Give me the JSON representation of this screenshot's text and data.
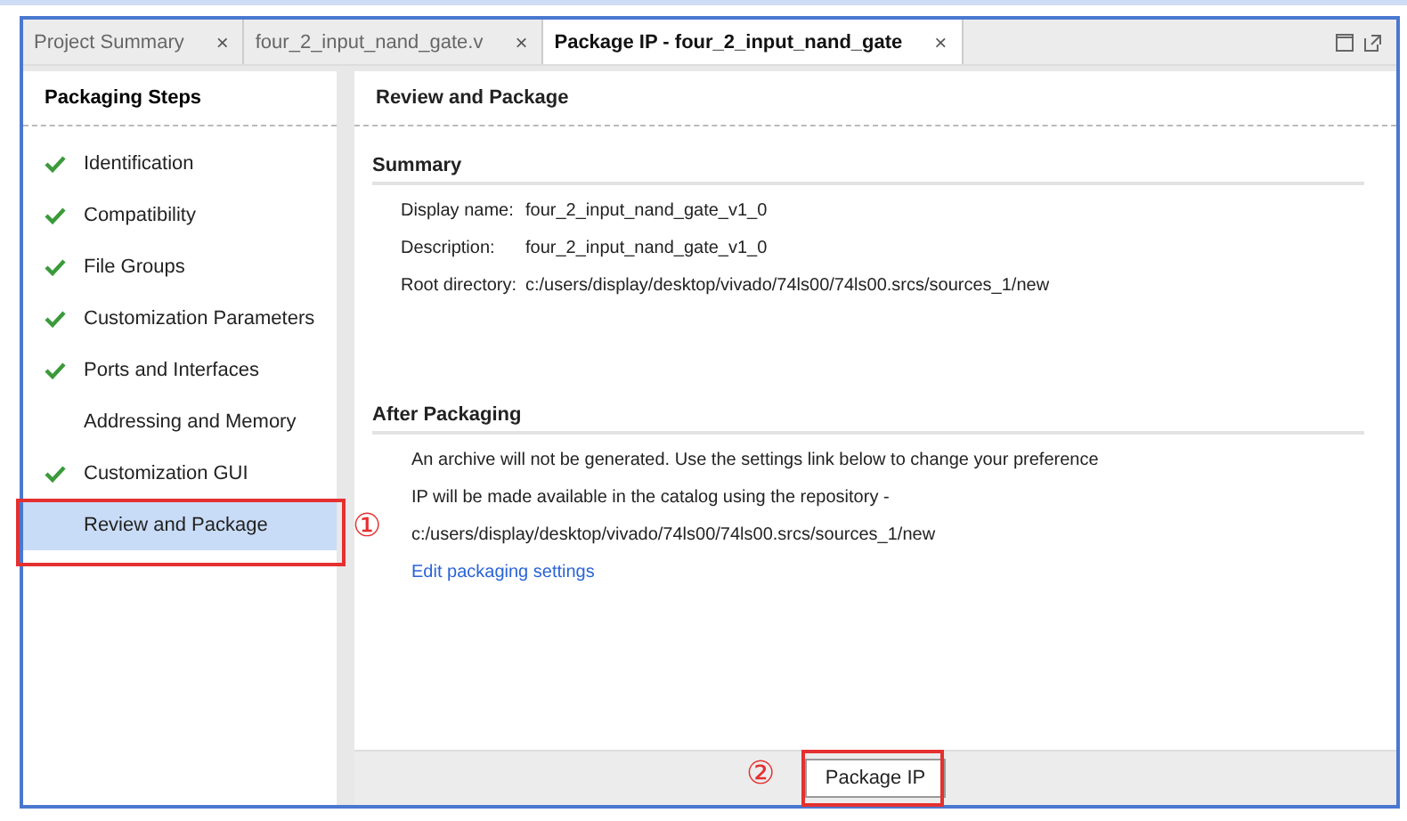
{
  "tabs": [
    {
      "label": "Project Summary",
      "selected": false,
      "close": "×"
    },
    {
      "label": "four_2_input_nand_gate.v",
      "selected": false,
      "close": "×"
    },
    {
      "label": "Package IP - four_2_input_nand_gate",
      "selected": true,
      "close": "×"
    }
  ],
  "sidebar": {
    "title": "Packaging Steps",
    "items": [
      {
        "label": "Identification",
        "done": true,
        "selected": false
      },
      {
        "label": "Compatibility",
        "done": true,
        "selected": false
      },
      {
        "label": "File Groups",
        "done": true,
        "selected": false
      },
      {
        "label": "Customization Parameters",
        "done": true,
        "selected": false
      },
      {
        "label": "Ports and Interfaces",
        "done": true,
        "selected": false
      },
      {
        "label": "Addressing and Memory",
        "done": false,
        "selected": false
      },
      {
        "label": "Customization GUI",
        "done": true,
        "selected": false
      },
      {
        "label": "Review and Package",
        "done": false,
        "selected": true
      }
    ]
  },
  "main": {
    "title": "Review and Package",
    "summary": {
      "title": "Summary",
      "rows": [
        {
          "label": "Display name:",
          "value": "four_2_input_nand_gate_v1_0"
        },
        {
          "label": "Description:",
          "value": "four_2_input_nand_gate_v1_0"
        },
        {
          "label": "Root directory:",
          "value": "c:/users/display/desktop/vivado/74ls00/74ls00.srcs/sources_1/new"
        }
      ]
    },
    "after": {
      "title": "After Packaging",
      "lines": [
        "An archive will not be generated. Use the settings link below to change your preference",
        "IP will be made available in the catalog using the repository -",
        "c:/users/display/desktop/vivado/74ls00/74ls00.srcs/sources_1/new"
      ],
      "link": "Edit packaging settings"
    },
    "button": "Package IP"
  },
  "annotations": [
    {
      "marker": "①"
    },
    {
      "marker": "②"
    }
  ]
}
